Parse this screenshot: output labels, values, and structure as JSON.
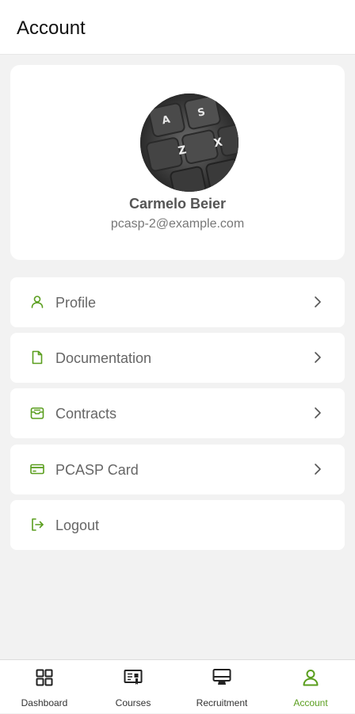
{
  "header": {
    "title": "Account"
  },
  "profile": {
    "name": "Carmelo Beier",
    "email": "pcasp-2@example.com",
    "avatar_keys": [
      "A",
      "S",
      "Z",
      "X"
    ]
  },
  "menu": [
    {
      "label": "Profile",
      "icon": "person-icon",
      "has_chevron": true
    },
    {
      "label": "Documentation",
      "icon": "document-icon",
      "has_chevron": true
    },
    {
      "label": "Contracts",
      "icon": "archive-icon",
      "has_chevron": true
    },
    {
      "label": "PCASP Card",
      "icon": "credit-card-icon",
      "has_chevron": true
    },
    {
      "label": "Logout",
      "icon": "logout-icon",
      "has_chevron": false
    }
  ],
  "bottom_nav": [
    {
      "label": "Dashboard",
      "icon": "grid-icon",
      "active": false
    },
    {
      "label": "Courses",
      "icon": "courses-icon",
      "active": false
    },
    {
      "label": "Recruitment",
      "icon": "monitor-icon",
      "active": false
    },
    {
      "label": "Account",
      "icon": "person-icon",
      "active": true
    }
  ],
  "colors": {
    "accent": "#5a9e1e",
    "background": "#f2f2f2",
    "card": "#ffffff"
  }
}
